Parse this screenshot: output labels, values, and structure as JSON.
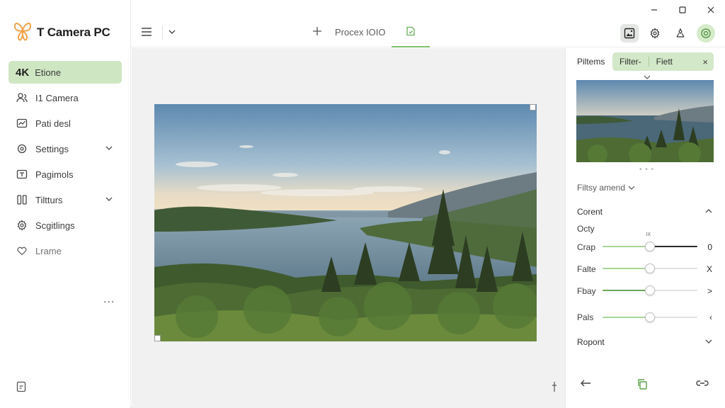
{
  "app": {
    "name": "T Camera PC",
    "colors": {
      "accent": "#cfe6c3",
      "accent_strong": "#7fbf6b",
      "canvas": "#f1f1f1"
    }
  },
  "window": {
    "traffic_lights": [
      "#ff5f57",
      "#febc2e",
      "#28c840"
    ],
    "controls": [
      "minimize-icon",
      "maximize-icon",
      "close-icon"
    ]
  },
  "sidebar": {
    "items": [
      {
        "badge": "4K",
        "label": "Etione",
        "icon": "4k-badge",
        "active": true
      },
      {
        "label": "I1 Camera",
        "icon": "people-icon"
      },
      {
        "label": "Pati desl",
        "icon": "chart-icon"
      },
      {
        "label": "Settings",
        "icon": "gear-icon",
        "expandable": true
      },
      {
        "label": "Pagimols",
        "icon": "text-box-icon"
      },
      {
        "label": "Tiltturs",
        "icon": "columns-icon",
        "expandable": true
      },
      {
        "label": "Scgitlings",
        "icon": "settings-icon"
      },
      {
        "label": "Lrame",
        "icon": "heart-icon"
      }
    ],
    "more": "...",
    "bottom_icon": "document-icon"
  },
  "toolbar": {
    "title": "Procex IOIO",
    "left_icons": [
      "menu-icon",
      "chevron-down-icon"
    ],
    "add_icon": "plus-icon",
    "tab_icon": "file-icon",
    "right_icons": [
      "image-icon",
      "gear-icon",
      "share-nodes-icon",
      "circle-badge-icon"
    ]
  },
  "panel": {
    "heading": "Piltems",
    "tabs": [
      "Filter-",
      "Fiett"
    ],
    "close": "×",
    "filter_select": "Filtsy amend",
    "section_a": "Corent",
    "sub_label": "Octy",
    "tiny_label": "ıx",
    "sliders": [
      {
        "label": "Crap",
        "value": 0.5,
        "end": "0"
      },
      {
        "label": "Falte",
        "value": 0.5,
        "end": "X"
      },
      {
        "label": "Fbay",
        "value": 0.5,
        "end": ">"
      },
      {
        "label": "Pals",
        "value": 0.5,
        "end": "‹"
      }
    ],
    "section_b": "Ropont",
    "footer_icons": [
      "arrow-left-icon",
      "copy-icon",
      "link-icon"
    ]
  },
  "canvas": {
    "pin_icon": "pin-icon"
  }
}
